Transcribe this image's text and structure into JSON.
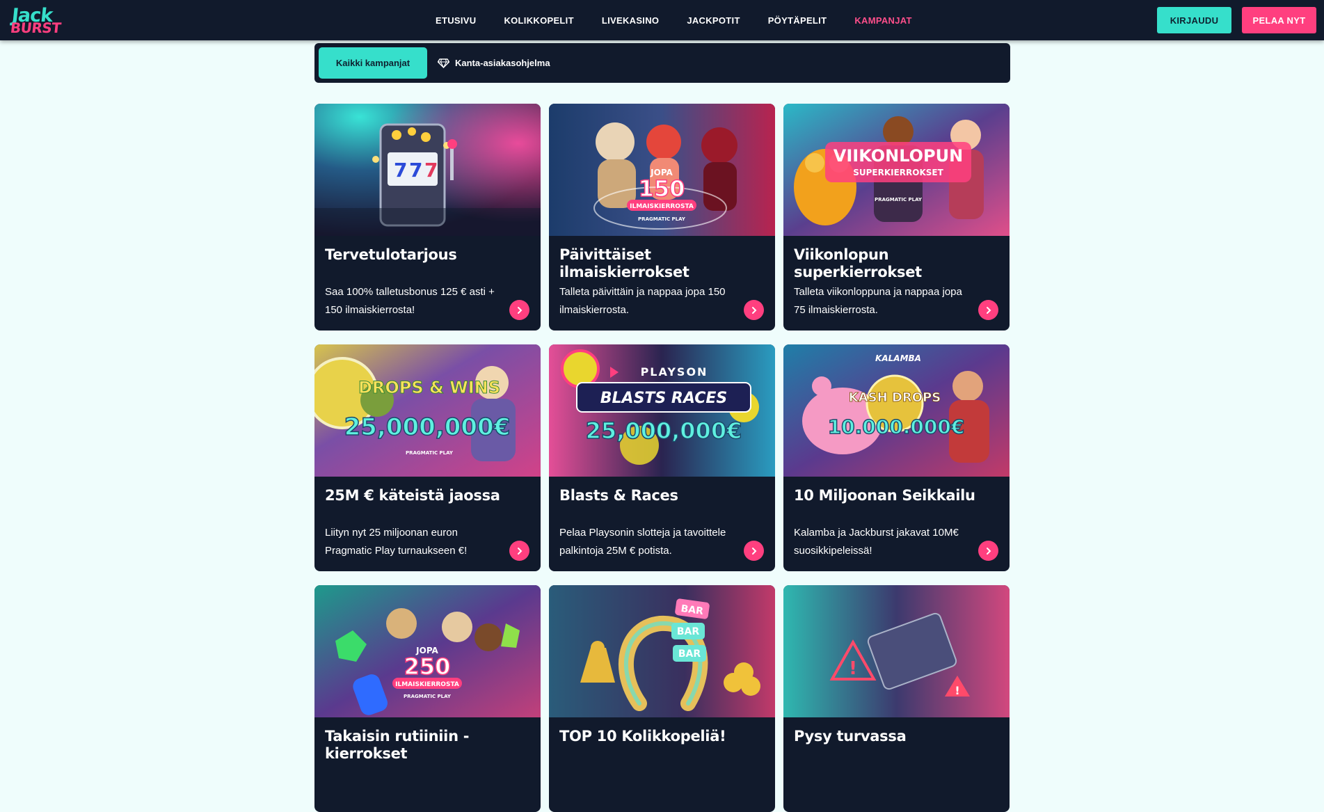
{
  "brand": {
    "line1": "Jack",
    "line2": "BURST"
  },
  "nav": {
    "items": [
      {
        "label": "ETUSIVU"
      },
      {
        "label": "KOLIKKOPELIT"
      },
      {
        "label": "LIVEKASINO"
      },
      {
        "label": "JACKPOTIT"
      },
      {
        "label": "PÖYTÄPELIT"
      },
      {
        "label": "KAMPANJAT",
        "active": true
      }
    ],
    "login_label": "KIRJAUDU",
    "play_label": "PELAA NYT"
  },
  "filters": {
    "all_label": "Kaikki kampanjat",
    "loyalty_label": "Kanta-asiakasohjelma"
  },
  "colors": {
    "accent": "#36dfcb",
    "brand_pink": "#ff3f7f",
    "panel": "#111a2c",
    "page_bg": "#effdfc"
  },
  "cards": [
    {
      "title": "Tervetulotarjous",
      "desc": "Saa 100% talletusbonus 125 € asti + 150 ilmaiskierrosta!",
      "image_icon": "slot-machine-icon",
      "overlay": {}
    },
    {
      "title": "Päivittäiset ilmaiskierrokset",
      "desc": "Talleta päivittäin ja nappaa jopa 150 ilmaiskierrosta.",
      "image_icon": "characters-icon",
      "overlay": {
        "small": "JOPA",
        "big": "150",
        "sub": "ILMAISKIERROSTA",
        "provider": "PRAGMATIC PLAY"
      }
    },
    {
      "title": "Viikonlopun superkierrokset",
      "desc": "Talleta viikonloppuna ja nappaa jopa 75 ilmaiskierrosta.",
      "image_icon": "cowboys-icon",
      "overlay": {
        "big": "VIIKONLOPUN",
        "sub": "SUPERKIERROKSET",
        "provider": "PRAGMATIC PLAY"
      }
    },
    {
      "title": "25M € käteistä jaossa",
      "desc": "Liityn nyt 25 miljoonan euron Pragmatic Play turnaukseen €!",
      "image_icon": "drops-wins-icon",
      "overlay": {
        "small": "DROPS & WINS",
        "big": "25,000,000€",
        "provider": "PRAGMATIC PLAY"
      }
    },
    {
      "title": "Blasts & Races",
      "desc": "Pelaa Playsonin slotteja ja tavoittele palkintoja 25M € potista.",
      "image_icon": "playson-icon",
      "overlay": {
        "provider": "PLAYSON",
        "small": "BLASTS RACES",
        "big": "25,000,000€"
      }
    },
    {
      "title": "10 Miljoonan Seikkailu",
      "desc": "Kalamba ja Jackburst jakavat 10M€ suosikkipeleissä!",
      "image_icon": "piggy-bank-icon",
      "overlay": {
        "provider": "KALAMBA",
        "small": "KASH DROPS",
        "big": "10.000.000€"
      }
    },
    {
      "title": "Takaisin rutiiniin - kierrokset",
      "desc": "",
      "image_icon": "gods-icon",
      "overlay": {
        "small": "JOPA",
        "big": "250",
        "sub": "ILMAISKIERROSTA",
        "provider": "PRAGMATIC PLAY"
      }
    },
    {
      "title": "TOP 10 Kolikkopeliä!",
      "desc": "",
      "image_icon": "horseshoe-icon",
      "overlay": {
        "small": "BAR"
      }
    },
    {
      "title": "Pysy turvassa",
      "desc": "",
      "image_icon": "warning-icon",
      "overlay": {}
    }
  ]
}
